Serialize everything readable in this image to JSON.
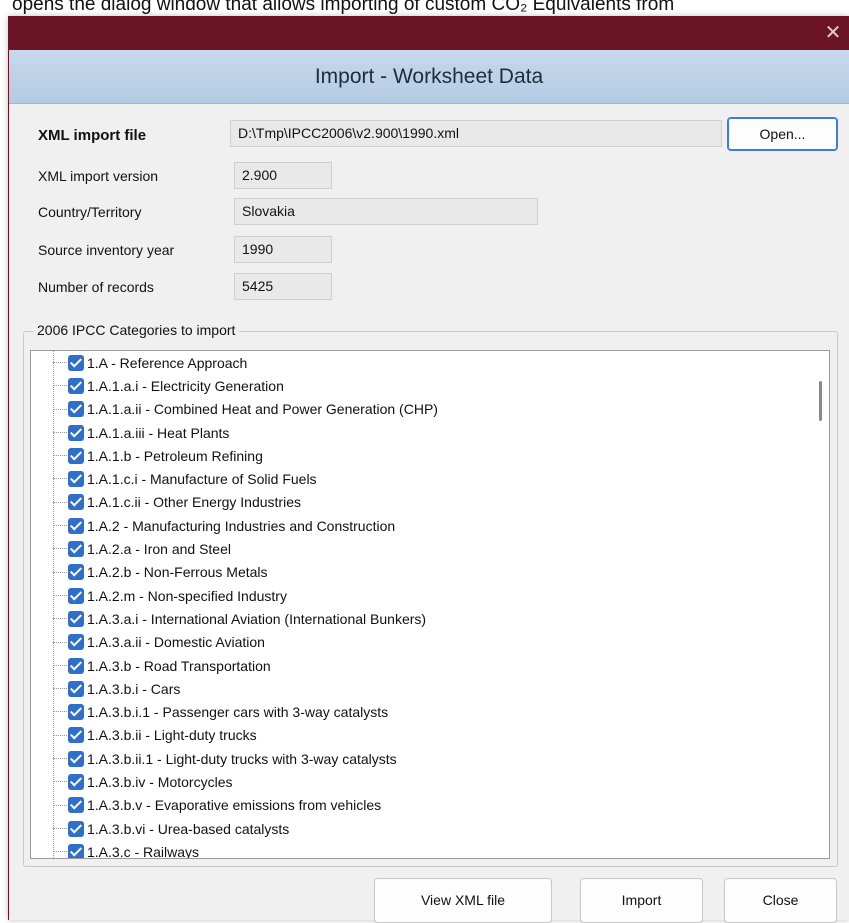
{
  "caption": "opens the dialog window that allows importing of custom CO₂ Equivalents from",
  "window": {
    "title": "Import - Worksheet Data",
    "close_glyph": "✕"
  },
  "fields": {
    "xml_import_file": {
      "label": "XML import file",
      "value": "D:\\Tmp\\IPCC2006\\v2.900\\1990.xml"
    },
    "xml_import_version": {
      "label": "XML import version",
      "value": "2.900"
    },
    "country": {
      "label": "Country/Territory",
      "value": "Slovakia"
    },
    "source_year": {
      "label": "Source inventory year",
      "value": "1990"
    },
    "records": {
      "label": "Number of records",
      "value": "5425"
    }
  },
  "buttons": {
    "open": "Open...",
    "view_xml": "View XML file",
    "import": "Import",
    "close": "Close"
  },
  "categories": {
    "legend": "2006 IPCC Categories to import",
    "items": [
      {
        "label": "1.A - Reference Approach",
        "checked": true
      },
      {
        "label": "1.A.1.a.i - Electricity Generation",
        "checked": true
      },
      {
        "label": "1.A.1.a.ii - Combined Heat and Power Generation (CHP)",
        "checked": true
      },
      {
        "label": "1.A.1.a.iii - Heat Plants",
        "checked": true
      },
      {
        "label": "1.A.1.b - Petroleum Refining",
        "checked": true
      },
      {
        "label": "1.A.1.c.i - Manufacture of Solid Fuels",
        "checked": true
      },
      {
        "label": "1.A.1.c.ii - Other Energy Industries",
        "checked": true
      },
      {
        "label": "1.A.2 - Manufacturing Industries and Construction",
        "checked": true
      },
      {
        "label": "1.A.2.a - Iron and Steel",
        "checked": true
      },
      {
        "label": "1.A.2.b - Non-Ferrous Metals",
        "checked": true
      },
      {
        "label": "1.A.2.m - Non-specified Industry",
        "checked": true
      },
      {
        "label": "1.A.3.a.i - International Aviation (International Bunkers)",
        "checked": true
      },
      {
        "label": "1.A.3.a.ii - Domestic Aviation",
        "checked": true
      },
      {
        "label": "1.A.3.b - Road Transportation",
        "checked": true
      },
      {
        "label": "1.A.3.b.i - Cars",
        "checked": true
      },
      {
        "label": "1.A.3.b.i.1 - Passenger cars with 3-way catalysts",
        "checked": true
      },
      {
        "label": "1.A.3.b.ii - Light-duty trucks",
        "checked": true
      },
      {
        "label": "1.A.3.b.ii.1 - Light-duty trucks with 3-way catalysts",
        "checked": true
      },
      {
        "label": "1.A.3.b.iv - Motorcycles",
        "checked": true
      },
      {
        "label": "1.A.3.b.v - Evaporative emissions from vehicles",
        "checked": true
      },
      {
        "label": "1.A.3.b.vi - Urea-based catalysts",
        "checked": true
      },
      {
        "label": "1.A.3.c - Railways",
        "checked": true
      }
    ]
  },
  "colors": {
    "titlebar": "#6b1428",
    "banner": "#c7d9ec",
    "checkbox": "#2f6fc9",
    "dialog_bg": "#f0f0f0"
  }
}
